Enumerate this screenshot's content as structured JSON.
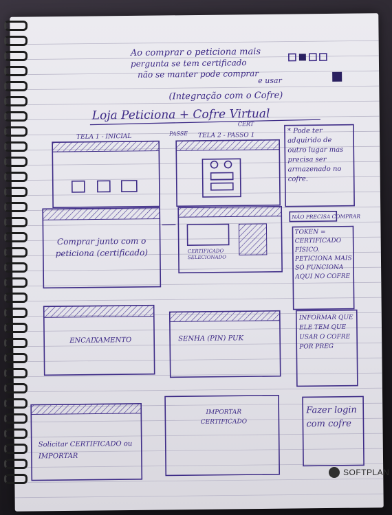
{
  "photo": {
    "subject": "notebook-sketch",
    "ink_color": "#3d2a86",
    "paper_color": "#e8e7ec",
    "header_notes": [
      "Ao comprar o peticiona mais",
      "pergunta se tem certificado",
      "não se manter pode comprar",
      "e usar"
    ],
    "header_subtitle": "(Integração com o Cofre)",
    "title": "Loja Peticiona + Cofre Virtual",
    "screens": [
      {
        "label": "TELA 1 - INICIAL",
        "caption": ""
      },
      {
        "label": "TELA 2 - PASSO 1",
        "caption": ""
      },
      {
        "label": "",
        "caption": "Comprar junto com o peticiona (certificado)"
      },
      {
        "label": "",
        "caption": "CERTIFICADO SELECIONADO"
      },
      {
        "label": "",
        "caption": "ENCAIXAMENTO"
      },
      {
        "label": "",
        "caption": "SENHA (PIN) PUK"
      },
      {
        "label": "",
        "caption": "Solicitar CERTIFICADO ou IMPORTAR"
      },
      {
        "label": "",
        "caption": "IMPORTAR CERTIFICADO"
      }
    ],
    "side_notes": [
      "* Pode ter adquirido de outro lugar mas precisa ser armazenado no cofre.",
      "NÃO PRECISA COMPRAR",
      "TOKEN = CERTIFICADO FÍSICO. PETICIONA MAIS SÓ FUNCIONA AQUI NO COFRE",
      "INFORMAR QUE ELE TEM QUE USAR O COFRE POR PREG",
      "Fazer login com cofre"
    ],
    "small_labels": [
      "PASSE",
      "CERT"
    ],
    "brand": "SOFTPLAN"
  }
}
